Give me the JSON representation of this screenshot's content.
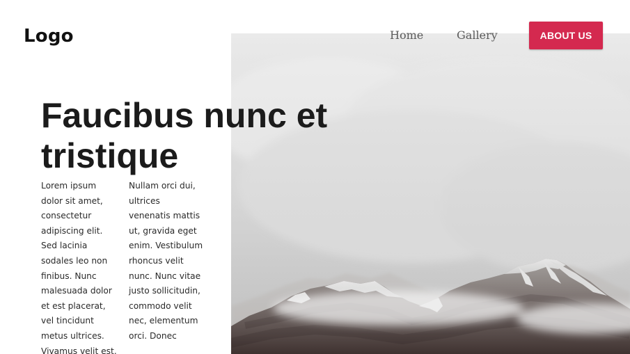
{
  "header": {
    "logo": "Logo",
    "nav": {
      "home": "Home",
      "gallery": "Gallery"
    },
    "cta": {
      "label": "ABOUT US",
      "color": "#d4294f"
    }
  },
  "hero": {
    "title": "Faucibus nunc et tristique",
    "columns": [
      {
        "text": "Lorem ipsum dolor sit amet, consectetur adipiscing elit. Sed lacinia sodales leo non finibus. Nunc malesuada dolor et est placerat, vel tincidunt metus ultrices. Vivamus velit est,"
      },
      {
        "text": "Nullam orci dui, ultrices venenatis mattis ut, gravida eget enim. Vestibulum rhoncus velit nunc. Nunc vitae justo sollicitudin, commodo velit nec, elementum orci. Donec"
      }
    ],
    "image": {
      "subject": "snowy mountain peak in fog"
    }
  }
}
